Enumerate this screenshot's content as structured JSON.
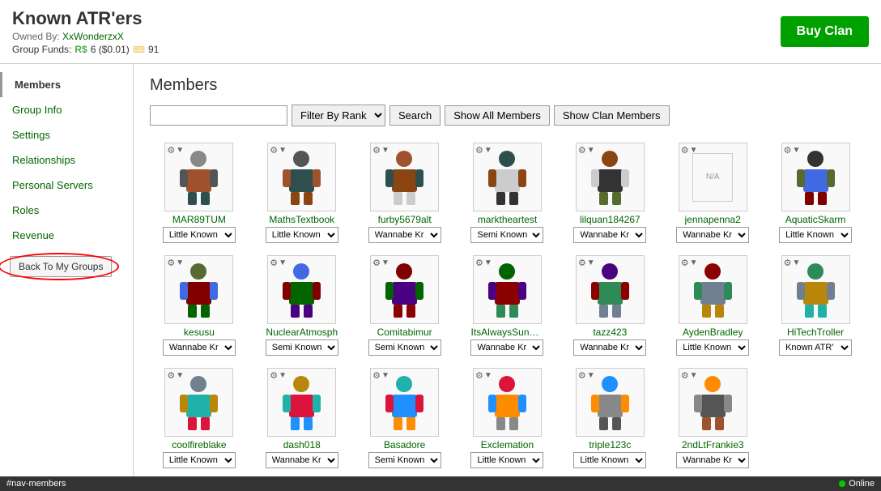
{
  "header": {
    "title": "Known ATR'ers",
    "owned_label": "Owned By:",
    "owner_name": "XxWonderzxX",
    "group_funds_label": "Group Funds:",
    "funds_robux": "R$6 ($0.01)",
    "funds_tickets": "91",
    "buy_clan_label": "Buy Clan"
  },
  "sidebar": {
    "items": [
      {
        "label": "Members",
        "active": true
      },
      {
        "label": "Group Info",
        "active": false
      },
      {
        "label": "Settings",
        "active": false
      },
      {
        "label": "Relationships",
        "active": false
      },
      {
        "label": "Personal Servers",
        "active": false
      },
      {
        "label": "Roles",
        "active": false
      },
      {
        "label": "Revenue",
        "active": false
      }
    ],
    "back_button": "Back To My Groups"
  },
  "main": {
    "section_title": "Members",
    "search_placeholder": "",
    "filter_label": "Filter By Rank",
    "search_button": "Search",
    "show_all_button": "Show All Members",
    "show_clan_button": "Show Clan Members",
    "rank_options": [
      "Little Known",
      "Wannabe Kr",
      "Semi Known",
      "Known ATR'",
      "Little Known"
    ]
  },
  "members": [
    {
      "name": "MAR89TUM",
      "rank": "Little Known",
      "avatar": "🧍"
    },
    {
      "name": "MathsTextbook",
      "rank": "Little Known",
      "avatar": "🧍"
    },
    {
      "name": "furby5679alt",
      "rank": "Wannabe Kr",
      "avatar": "🧍"
    },
    {
      "name": "marktheartest",
      "rank": "Semi Known",
      "avatar": "🧍"
    },
    {
      "name": "lilquan184267",
      "rank": "Wannabe Kr",
      "avatar": "🧍"
    },
    {
      "name": "jennapenna2",
      "rank": "Wannabe Kr",
      "avatar": "🧍"
    },
    {
      "name": "AquaticSkarm",
      "rank": "Little Known",
      "avatar": "🧍"
    },
    {
      "name": "kesusu",
      "rank": "Wannabe Kr",
      "avatar": "🧍"
    },
    {
      "name": "NuclearAtmosph",
      "rank": "Semi Known",
      "avatar": "🧍"
    },
    {
      "name": "Comitabimur",
      "rank": "Semi Known",
      "avatar": "🧍"
    },
    {
      "name": "ItsAlwaysSunnyIr",
      "rank": "Wannabe Kr",
      "avatar": "🧍"
    },
    {
      "name": "tazz423",
      "rank": "Wannabe Kr",
      "avatar": "🧍"
    },
    {
      "name": "AydenBradley",
      "rank": "Little Known",
      "avatar": "🧍"
    },
    {
      "name": "HiTechTroller",
      "rank": "Known ATR'",
      "avatar": "🧍"
    },
    {
      "name": "coolfireblake",
      "rank": "Little Known",
      "avatar": "🧍"
    },
    {
      "name": "dash018",
      "rank": "Wannabe Kr",
      "avatar": "🧍"
    },
    {
      "name": "Basadore",
      "rank": "Semi Known",
      "avatar": "🧍"
    },
    {
      "name": "Exclemation",
      "rank": "Little Known",
      "avatar": "🧍"
    },
    {
      "name": "triple123c",
      "rank": "Little Known",
      "avatar": "🧍"
    },
    {
      "name": "2ndLtFrankie3",
      "rank": "Wannabe Kr",
      "avatar": "🧍"
    }
  ],
  "status_bar": {
    "url": "#nav-members",
    "online_label": "Online"
  }
}
